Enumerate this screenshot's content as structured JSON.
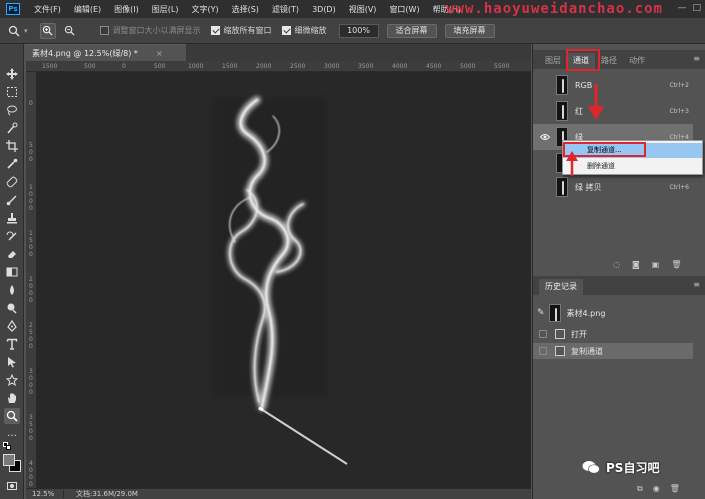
{
  "app": {
    "logo_text": "Ps"
  },
  "menubar": {
    "items": [
      "文件(F)",
      "编辑(E)",
      "图像(I)",
      "图层(L)",
      "文字(Y)",
      "选择(S)",
      "滤镜(T)",
      "3D(D)",
      "视图(V)",
      "窗口(W)",
      "帮助(H)"
    ],
    "watermark": "www.haoyuweidanchao.com"
  },
  "optionsbar": {
    "resize_windows_label": "调整窗口大小以满屏显示",
    "zoom_all_label": "缩放所有窗口",
    "scrubby_zoom_label": "细微缩放",
    "zoom_value": "100%",
    "fit_screen_label": "适合屏幕",
    "fill_screen_label": "填充屏幕"
  },
  "document": {
    "tab_title": "素材4.png @ 12.5%(绿/8) *",
    "close": "×",
    "ruler_top": [
      "1500",
      "500",
      "0",
      "500",
      "1000",
      "1500",
      "2000",
      "2500",
      "3000",
      "3500",
      "4000",
      "4500",
      "5000",
      "5500"
    ],
    "ruler_left": [
      "0",
      "5 0 0",
      "1 0 0 0",
      "1 5 0 0",
      "2 0 0 0",
      "2 5 0 0",
      "3 0 0 0",
      "3 5 0 0",
      "4 0 0 0"
    ]
  },
  "status": {
    "zoom": "12.5%",
    "doc_info": "文档:31.6M/29.0M"
  },
  "channels_panel": {
    "tabs": [
      "图层",
      "通道",
      "路径",
      "动作"
    ],
    "active_tab": "通道",
    "channels": [
      {
        "name": "RGB",
        "shortcut": "Ctrl+2",
        "visible": false
      },
      {
        "name": "红",
        "shortcut": "Ctrl+3",
        "visible": false
      },
      {
        "name": "绿",
        "shortcut": "Ctrl+4",
        "visible": true,
        "selected": true
      },
      {
        "name": "",
        "shortcut": "",
        "visible": false
      },
      {
        "name": "绿 拷贝",
        "shortcut": "Ctrl+6",
        "visible": false
      }
    ],
    "context_menu": [
      "复制通道...",
      "删除通道"
    ]
  },
  "history_panel": {
    "title": "历史记录",
    "snapshot": "素材4.png",
    "states": [
      "打开",
      "复制通道"
    ]
  },
  "bottom_watermark": "PS自习吧",
  "colors": {
    "annotation_red": "#e0262d",
    "menu_highlight": "#98c6f2"
  }
}
